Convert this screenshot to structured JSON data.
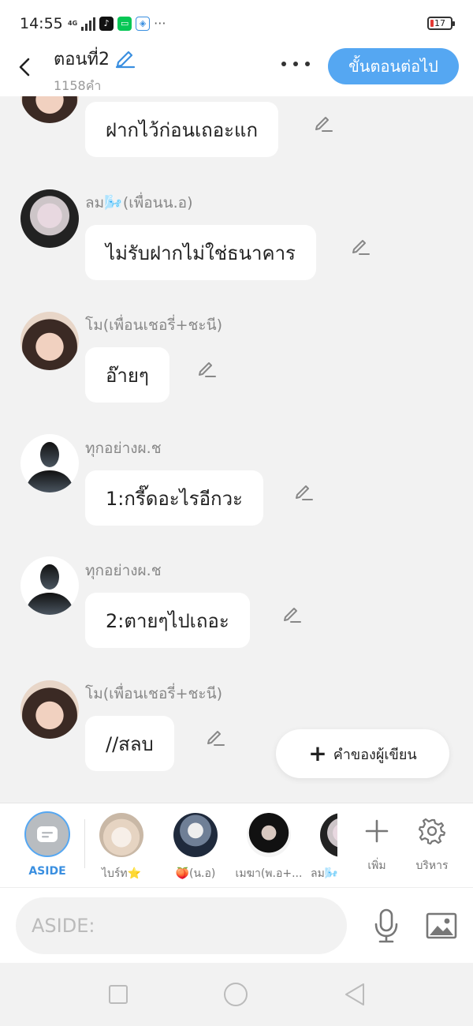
{
  "status_bar": {
    "time": "14:55",
    "network": "4G",
    "battery": "17",
    "more": "···"
  },
  "header": {
    "title": "ตอนที่2",
    "word_count": "1158คำ",
    "next_button": "ขั้นตอนต่อไป",
    "accent_color": "#55a7f2"
  },
  "messages": [
    {
      "sender": "",
      "text": "ฝากไว้ก่อนเถอะแก",
      "avatar": "girl-avatar"
    },
    {
      "sender": "ลม🌬️(เพื่อนน.อ)",
      "text": "ไม่รับฝากไม่ใช่ธนาคาร",
      "avatar": "white-hair-avatar"
    },
    {
      "sender": "โม(เพื่อนเชอรี่+ชะนี)",
      "text": "อ๊ายๆ",
      "avatar": "girl-avatar"
    },
    {
      "sender": "ทุกอย่างผ.ช",
      "text": "1:กรี๊ดอะไรอีกวะ",
      "avatar": "silhouette-avatar"
    },
    {
      "sender": "ทุกอย่างผ.ช",
      "text": "2:ตายๆไปเถอะ",
      "avatar": "silhouette-avatar"
    },
    {
      "sender": "โม(เพื่อนเชอรี่+ชะนี)",
      "text": "//สลบ",
      "avatar": "girl-avatar"
    }
  ],
  "fab": {
    "label": "คำของผู้เขียน"
  },
  "characters": {
    "aside_label": "ASIDE",
    "items": [
      {
        "name": "ไบร์ท⭐"
      },
      {
        "name": "🍑(น.อ)"
      },
      {
        "name": "เมฆา(พ.อ+..."
      },
      {
        "name": "ลม🌬️"
      }
    ],
    "add_label": "เพิ่ม",
    "manage_label": "บริหาร"
  },
  "input": {
    "placeholder": "ASIDE:"
  }
}
